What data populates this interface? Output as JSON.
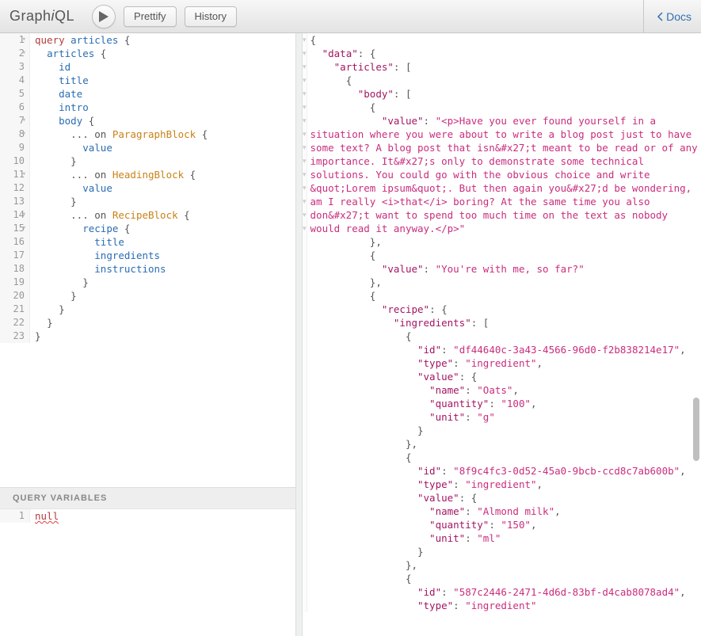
{
  "toolbar": {
    "prettify": "Prettify",
    "history": "History",
    "docs": "Docs"
  },
  "vars": {
    "header": "Query Variables",
    "content": "null"
  },
  "query": {
    "name": "articles",
    "lines": [
      {
        "n": 1,
        "fold": true,
        "tokens": [
          [
            "kw",
            "query "
          ],
          [
            "def",
            "articles"
          ],
          [
            "punct",
            " {"
          ]
        ]
      },
      {
        "n": 2,
        "fold": true,
        "tokens": [
          [
            "",
            "  "
          ],
          [
            "field",
            "articles"
          ],
          [
            "punct",
            " {"
          ]
        ]
      },
      {
        "n": 3,
        "tokens": [
          [
            "",
            "    "
          ],
          [
            "attr",
            "id"
          ]
        ]
      },
      {
        "n": 4,
        "tokens": [
          [
            "",
            "    "
          ],
          [
            "attr",
            "title"
          ]
        ]
      },
      {
        "n": 5,
        "tokens": [
          [
            "",
            "    "
          ],
          [
            "attr",
            "date"
          ]
        ]
      },
      {
        "n": 6,
        "tokens": [
          [
            "",
            "    "
          ],
          [
            "attr",
            "intro"
          ]
        ]
      },
      {
        "n": 7,
        "fold": true,
        "tokens": [
          [
            "",
            "    "
          ],
          [
            "attr",
            "body"
          ],
          [
            "punct",
            " {"
          ]
        ]
      },
      {
        "n": 8,
        "fold": true,
        "tokens": [
          [
            "",
            "      "
          ],
          [
            "punct",
            "... on "
          ],
          [
            "frag",
            "ParagraphBlock"
          ],
          [
            "punct",
            " {"
          ]
        ]
      },
      {
        "n": 9,
        "tokens": [
          [
            "",
            "        "
          ],
          [
            "attr",
            "value"
          ]
        ]
      },
      {
        "n": 10,
        "tokens": [
          [
            "",
            "      "
          ],
          [
            "punct",
            "}"
          ]
        ]
      },
      {
        "n": 11,
        "fold": true,
        "tokens": [
          [
            "",
            "      "
          ],
          [
            "punct",
            "... on "
          ],
          [
            "frag",
            "HeadingBlock"
          ],
          [
            "punct",
            " {"
          ]
        ]
      },
      {
        "n": 12,
        "tokens": [
          [
            "",
            "        "
          ],
          [
            "attr",
            "value"
          ]
        ]
      },
      {
        "n": 13,
        "tokens": [
          [
            "",
            "      "
          ],
          [
            "punct",
            "}"
          ]
        ]
      },
      {
        "n": 14,
        "fold": true,
        "tokens": [
          [
            "",
            "      "
          ],
          [
            "punct",
            "... on "
          ],
          [
            "frag",
            "RecipeBlock"
          ],
          [
            "punct",
            " {"
          ]
        ]
      },
      {
        "n": 15,
        "fold": true,
        "tokens": [
          [
            "",
            "        "
          ],
          [
            "attr",
            "recipe"
          ],
          [
            "punct",
            " {"
          ]
        ]
      },
      {
        "n": 16,
        "tokens": [
          [
            "",
            "          "
          ],
          [
            "attr",
            "title"
          ]
        ]
      },
      {
        "n": 17,
        "tokens": [
          [
            "",
            "          "
          ],
          [
            "attr",
            "ingredients"
          ]
        ]
      },
      {
        "n": 18,
        "tokens": [
          [
            "",
            "          "
          ],
          [
            "attr",
            "instructions"
          ]
        ]
      },
      {
        "n": 19,
        "tokens": [
          [
            "",
            "        "
          ],
          [
            "punct",
            "}"
          ]
        ]
      },
      {
        "n": 20,
        "tokens": [
          [
            "",
            "      "
          ],
          [
            "punct",
            "}"
          ]
        ]
      },
      {
        "n": 21,
        "tokens": [
          [
            "",
            "    "
          ],
          [
            "punct",
            "}"
          ]
        ]
      },
      {
        "n": 22,
        "tokens": [
          [
            "",
            "  "
          ],
          [
            "punct",
            "}"
          ]
        ]
      },
      {
        "n": 23,
        "tokens": [
          [
            "punct",
            "}"
          ]
        ]
      }
    ]
  },
  "result": {
    "data": {
      "articles": [
        {
          "body": [
            {
              "value": "<p>Have you ever found yourself in a situation where you were about to write a blog post just to have some text? A blog post that isn&#x27;t meant to be read or of any importance. It&#x27;s only to demonstrate some technical solutions. You could go with the obvious choice and write &quot;Lorem ipsum&quot;. But then again you&#x27;d be wondering, am I really <i>that</i> boring? At the same time you also don&#x27;t want to spend too much time on the text as nobody would read it anyway.</p>"
            },
            {
              "value": "You're with me, so far?"
            },
            {
              "recipe": {
                "ingredients": [
                  {
                    "id": "df44640c-3a43-4566-96d0-f2b838214e17",
                    "type": "ingredient",
                    "value": {
                      "name": "Oats",
                      "quantity": "100",
                      "unit": "g"
                    }
                  },
                  {
                    "id": "8f9c4fc3-0d52-45a0-9bcb-ccd8c7ab600b",
                    "type": "ingredient",
                    "value": {
                      "name": "Almond milk",
                      "quantity": "150",
                      "unit": "ml"
                    }
                  },
                  {
                    "id": "587c2446-2471-4d6d-83bf-d4cab8078ad4",
                    "type": "ingredient"
                  }
                ]
              }
            }
          ]
        }
      ]
    }
  }
}
